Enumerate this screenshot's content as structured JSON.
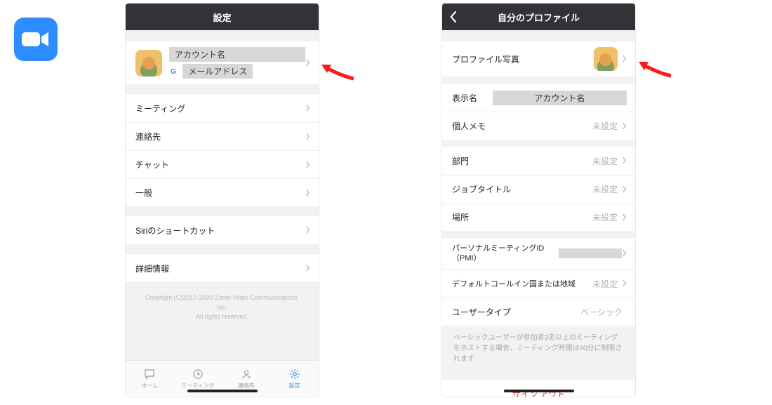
{
  "app_icon_name": "zoom-logo-icon",
  "left": {
    "header_title": "設定",
    "account_name": "アカウント名",
    "email_label": "メールアドレス",
    "menu": [
      {
        "label": "ミーティング"
      },
      {
        "label": "連絡先"
      },
      {
        "label": "チャット"
      },
      {
        "label": "一般"
      }
    ],
    "siri_label": "Siriのショートカット",
    "details_label": "詳細情報",
    "copyright": "Copyright (C)2012-2020 Zoom Video Communications, Inc.\nAll rights reserved.",
    "tabs": {
      "home": "ホーム",
      "meeting": "ミーティング",
      "contacts": "連絡先",
      "settings": "設定"
    }
  },
  "right": {
    "header_title": "自分のプロファイル",
    "rows": {
      "photo_label": "プロファイル写真",
      "display_name_label": "表示名",
      "display_name_value": "アカウント名",
      "memo_label": "個人メモ",
      "memo_value": "未設定",
      "dept_label": "部門",
      "dept_value": "未設定",
      "jobtitle_label": "ジョブタイトル",
      "jobtitle_value": "未設定",
      "location_label": "場所",
      "location_value": "未設定",
      "pmi_label": "パーソナルミーティングID（PMI）",
      "callin_label": "デフォルトコールイン国または地域",
      "callin_value": "未設定",
      "usertype_label": "ユーザータイプ",
      "usertype_value": "ベーシック"
    },
    "note": "ベーシックユーザーが参加者3名以上のミーティングをホストする場合、ミーティング時間は40分に制限されます",
    "signout": "サイン アウト"
  }
}
